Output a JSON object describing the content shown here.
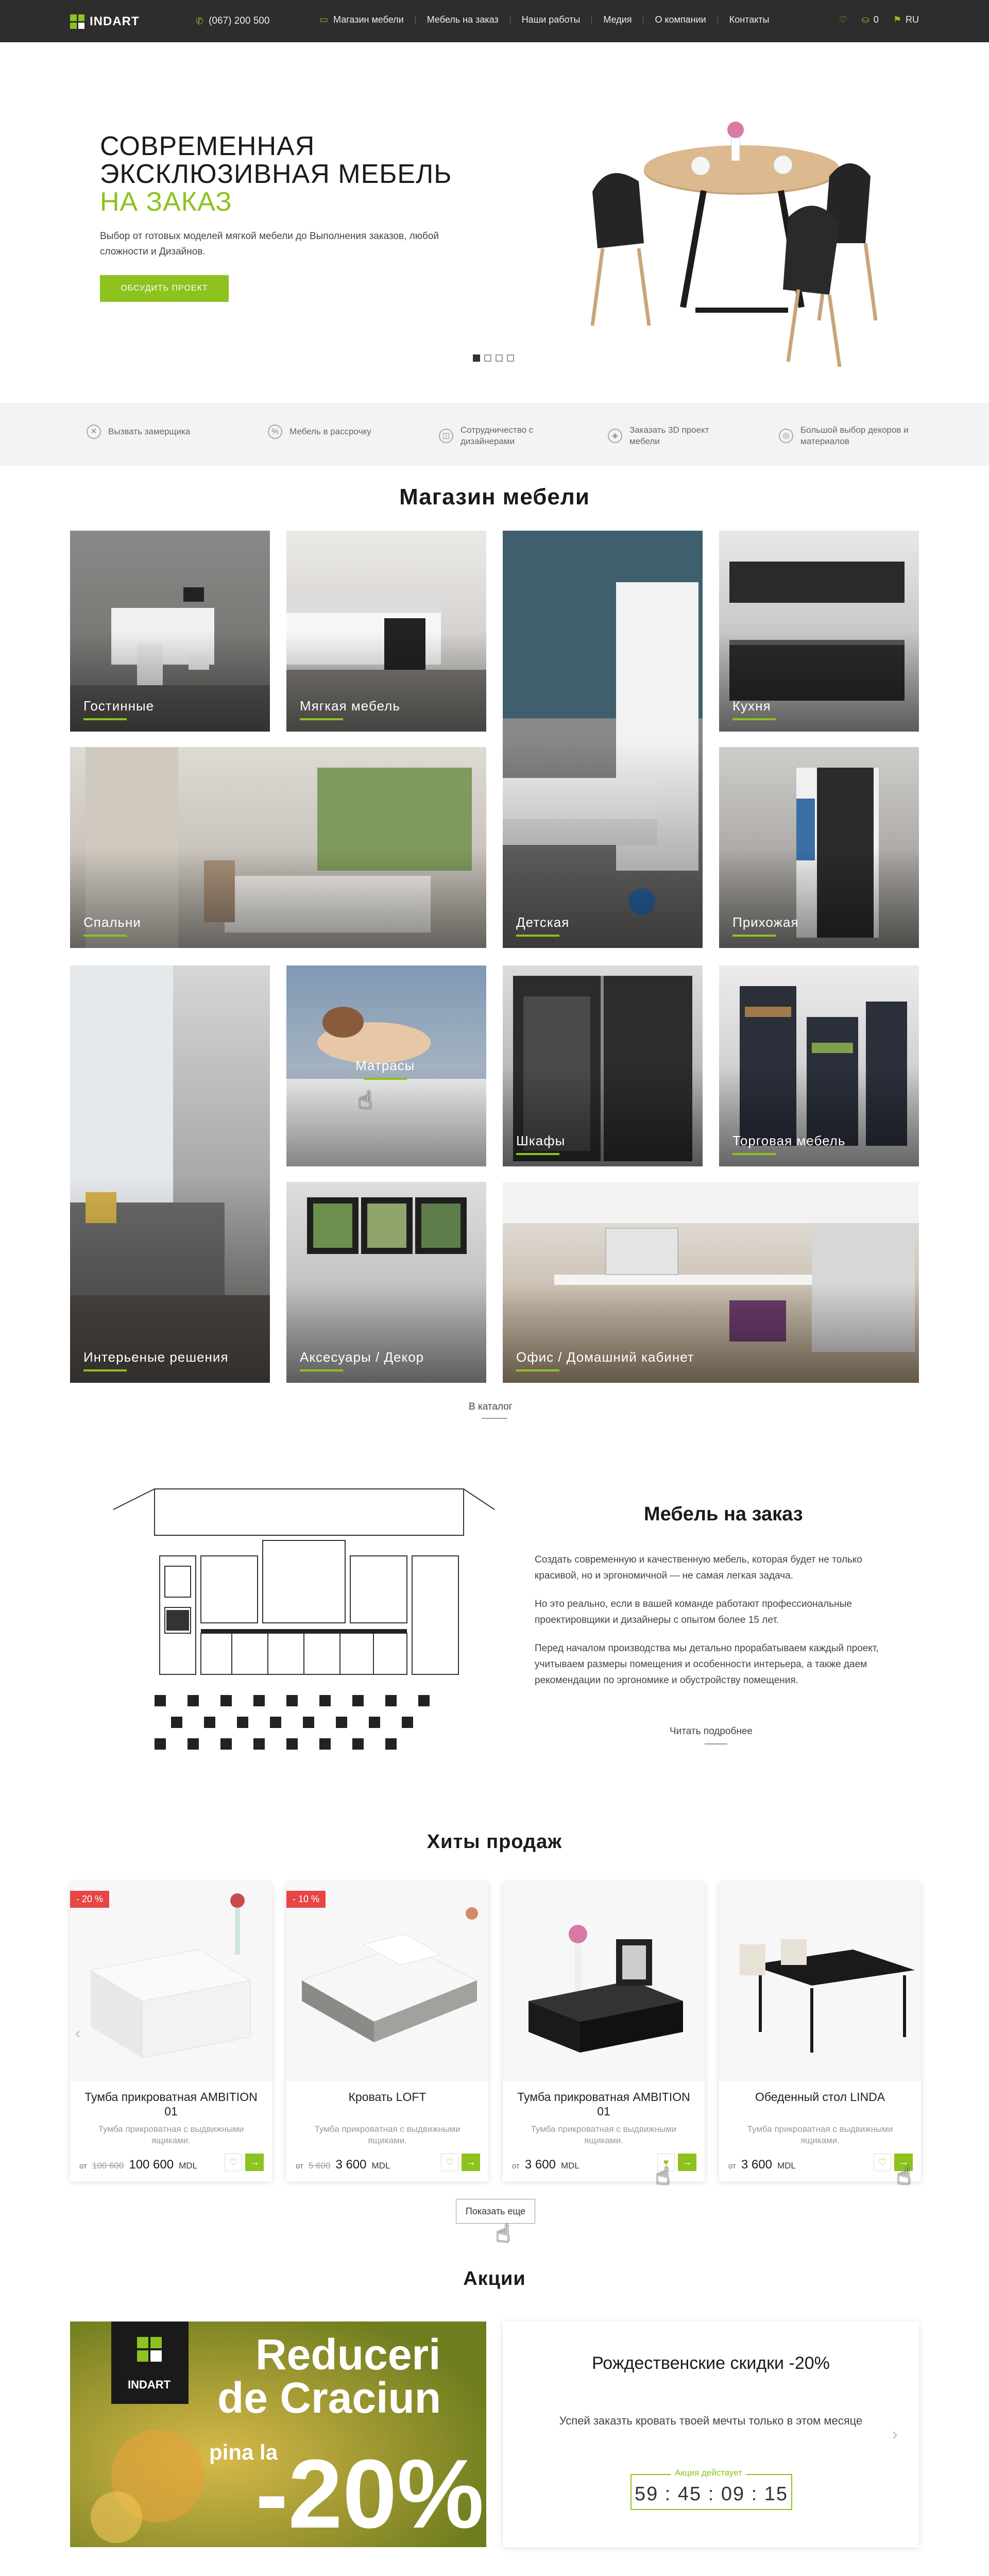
{
  "header": {
    "logo": "INDART",
    "phone": "(067) 200 500",
    "nav": [
      "Магазин мебели",
      "Мебель на заказ",
      "Наши работы",
      "Медия",
      "О компании",
      "Контакты"
    ],
    "cart_count": "0",
    "lang": "RU",
    "accent_color": "#8dc21f",
    "bg_color": "#2d2d2d"
  },
  "hero": {
    "title_line1": "СОВРЕМЕННАЯ",
    "title_line2": "ЭКСКЛЮЗИВНАЯ МЕБЕЛЬ",
    "title_accent": "НА ЗАКАЗ",
    "subtitle": "Выбор от готовых моделей мягкой мебели до Выполнения заказов, любой сложности и Дизайнов.",
    "button": "ОБСУДИТЬ ПРОЕКТ",
    "slides": 4,
    "active_slide": 1
  },
  "features": [
    {
      "icon": "ruler-icon",
      "label": "Вызвать замерщика"
    },
    {
      "icon": "percent-icon",
      "label": "Мебель в рассрочку"
    },
    {
      "icon": "handshake-icon",
      "label": "Сотрудничество с дизайнерами"
    },
    {
      "icon": "cube-icon",
      "label": "Заказать 3D проект мебели"
    },
    {
      "icon": "palette-icon",
      "label": "Большой выбор декоров и материалов"
    }
  ],
  "shop": {
    "title": "Магазин мебели",
    "tiles": [
      "Гостинные",
      "Мягкая мебель",
      "Детская",
      "Кухня",
      "Спальни",
      "Прихожая",
      "Матрасы",
      "Шкафы",
      "Торговая мебель",
      "Интерьеные решения",
      "Аксесуары / Декор",
      "Офис / Домашний кабинет"
    ],
    "catalog_link": "В каталог"
  },
  "custom": {
    "title": "Мебель на заказ",
    "p1": "Создать современную и качественную мебель, которая будет не только красивой, но и эргономичной — не самая легкая задача.",
    "p2": "Но это реально, если в вашей команде работают профессиональные проектировщики и дизайнеры с опытом более 15 лет.",
    "p3": "Перед началом производства мы детально прорабатываем каждый проект, учитываем размеры помещения и особенности интерьера, а также даем рекомендации по эргономике и обустройству помещения.",
    "read_more": "Читать подробнее"
  },
  "hits": {
    "title": "Хиты продаж",
    "products": [
      {
        "name": "Тумба прикроватная AMBITION 01",
        "desc": "Тумба прикроватная с выдвижными ящиками.",
        "from": "от",
        "old_price": "100 600",
        "price": "100 600",
        "currency": "MDL",
        "badge": "- 20 %"
      },
      {
        "name": "Кровать LOFT",
        "desc": "Тумба прикроватная с выдвижными ящиками.",
        "from": "от",
        "old_price": "5 600",
        "price": "3 600",
        "currency": "MDL",
        "badge": "- 10 %"
      },
      {
        "name": "Тумба прикроватная AMBITION 01",
        "desc": "Тумба прикроватная с выдвижными ящиками.",
        "from": "от",
        "old_price": "",
        "price": "3 600",
        "currency": "MDL",
        "badge": ""
      },
      {
        "name": "Обеденный стол LINDA",
        "desc": "Тумба прикроватная с выдвижными ящиками.",
        "from": "от",
        "old_price": "",
        "price": "3 600",
        "currency": "MDL",
        "badge": ""
      }
    ],
    "more_button": "Показать еще"
  },
  "promo": {
    "title": "Акции",
    "banner_logo": "INDART",
    "banner_line1": "Reduceri",
    "banner_line2": "de Craciun",
    "banner_small": "pina la",
    "banner_big": "-20%",
    "card_title": "Рождественские скидки -20%",
    "card_text": "Успей заказть кровать твоей мечты только в этом месяце",
    "timer_label": "Акция действует",
    "timer": "59 : 45 : 09 : 15"
  }
}
